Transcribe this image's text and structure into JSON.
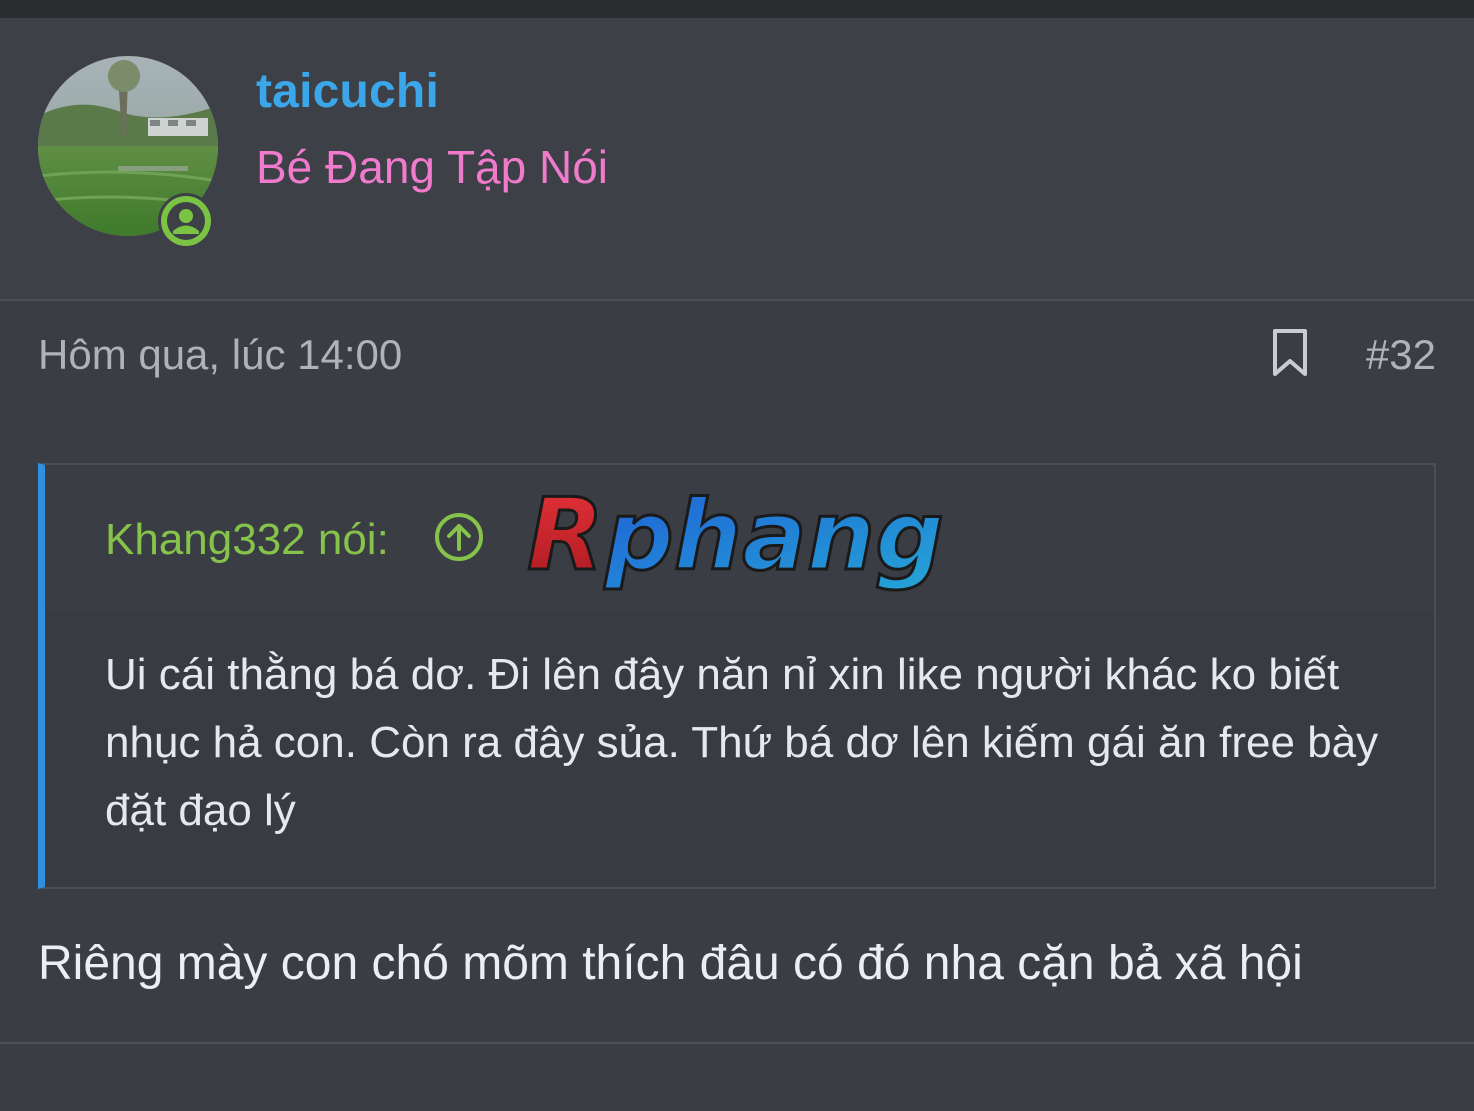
{
  "user": {
    "username": "taicuchi",
    "title": "Bé Đang Tập Nói",
    "avatar_icon": "landscape-avatar",
    "status_icon": "online-user-icon"
  },
  "post": {
    "date": "Hôm qua, lúc 14:00",
    "number": "#32",
    "bookmark_icon": "bookmark-icon"
  },
  "quote": {
    "attribution": "Khang332 nói:",
    "jump_icon": "arrow-up-circle-icon",
    "text": "Ui cái thằng bá dơ. Đi lên đây năn nỉ xin like người khác ko biết nhục hả con. Còn ra đây sủa. Thứ bá dơ lên kiếm gái ăn free bày đặt đạo lý"
  },
  "watermark": {
    "text": "Rphang"
  },
  "reply": {
    "text": "Riêng mày con chó mõm thích đâu có đó nha cặn bả xã hội"
  },
  "colors": {
    "username": "#3ba7ea",
    "user_title": "#f07acb",
    "quote_author": "#86c34b",
    "quote_border": "#2f8fe0",
    "background": "#3a3d43"
  }
}
